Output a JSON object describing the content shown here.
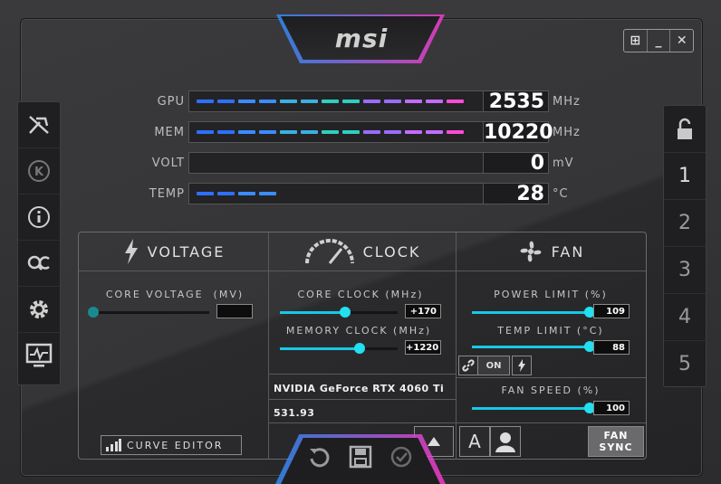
{
  "app": {
    "brand": "msi"
  },
  "window_controls": {
    "windows": "⊞",
    "minimize": "_",
    "close": "✕"
  },
  "left_sidebar": {
    "items": [
      "kombustor",
      "K",
      "info",
      "OC scanner",
      "settings",
      "monitor"
    ]
  },
  "right_sidebar": {
    "lock": "🔓",
    "profiles": [
      "1",
      "2",
      "3",
      "4",
      "5"
    ]
  },
  "monitor": {
    "gpu": {
      "label": "GPU",
      "value": "2535",
      "unit": "MHz",
      "fill": 1.0
    },
    "mem": {
      "label": "MEM",
      "value": "10220",
      "unit": "MHz",
      "fill": 1.0
    },
    "volt": {
      "label": "VOLT",
      "value": "0",
      "unit": "mV",
      "fill": 0.0
    },
    "temp": {
      "label": "TEMP",
      "value": "28",
      "unit": "°C",
      "fill": 0.3
    }
  },
  "voltage": {
    "title": "VOLTAGE",
    "core_voltage_label": "CORE VOLTAGE",
    "core_voltage_unit": "(MV)",
    "core_voltage_value": "",
    "core_voltage_level": 0.0,
    "curve_editor_label": "CURVE EDITOR"
  },
  "clock": {
    "title": "CLOCK",
    "core_clock_label": "CORE CLOCK",
    "core_clock_unit": "(MHz)",
    "core_clock_value": "+170",
    "core_clock_level": 0.55,
    "memory_clock_label": "MEMORY CLOCK",
    "memory_clock_unit": "(MHz)",
    "memory_clock_value": "+1220",
    "memory_clock_level": 0.68,
    "gpu_name": "NVIDIA GeForce RTX 4060 Ti",
    "driver_version": "531.93"
  },
  "fan": {
    "title": "FAN",
    "power_limit_label": "POWER LIMIT",
    "power_limit_unit": "(%)",
    "power_limit_value": "109",
    "power_limit_level": 1.0,
    "temp_limit_label": "TEMP LIMIT",
    "temp_limit_unit": "(°C)",
    "temp_limit_value": "88",
    "temp_limit_level": 1.0,
    "link_on_label": "ON",
    "fan_speed_label": "FAN SPEED",
    "fan_speed_unit": "(%)",
    "fan_speed_value": "100",
    "fan_speed_level": 1.0,
    "fan_sync_label_1": "FAN",
    "fan_sync_label_2": "SYNC",
    "auto_label": "A"
  },
  "colors": {
    "accent": "#22e0f0",
    "segment_colors": [
      "#2f6fff",
      "#3a8cff",
      "#3ab0e0",
      "#2ecfc0",
      "#9b6bff",
      "#c56bff",
      "#ff4bd8"
    ]
  }
}
